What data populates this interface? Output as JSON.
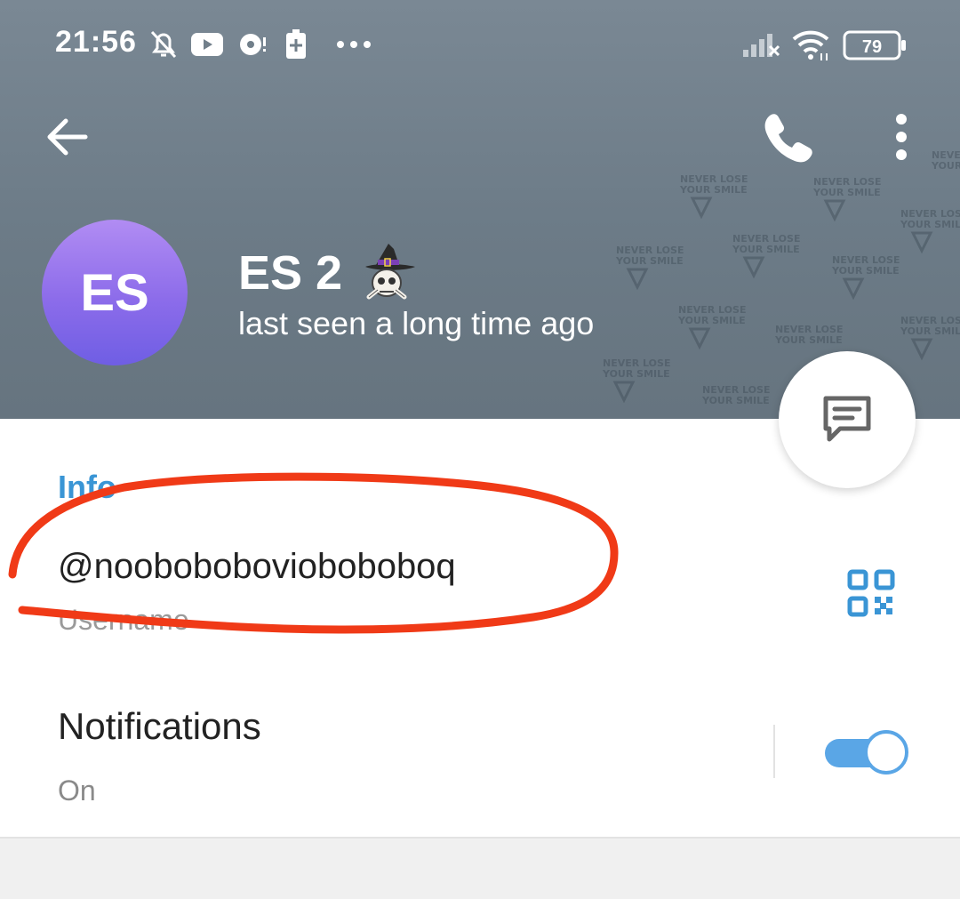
{
  "status_bar": {
    "time": "21:56",
    "battery_level": "79",
    "icons": [
      "bell-off-icon",
      "youtube-icon",
      "tape-recorder-icon",
      "battery-saver-icon",
      "more-dots-icon",
      "signal-icon",
      "wifi-icon",
      "battery-icon"
    ]
  },
  "toolbar": {
    "back_icon": "arrow-left-icon",
    "call_icon": "phone-icon",
    "more_icon": "more-vertical-icon"
  },
  "profile": {
    "avatar_initials": "ES",
    "name": "ES 2",
    "status": "last seen a long time ago",
    "avatar_color": "#8c6cea"
  },
  "background_pattern_text": [
    "NEVER LOSE",
    "YOUR SMILE"
  ],
  "info": {
    "section_title": "Info",
    "username": "@noobobobovioboboboq",
    "username_label": "Username",
    "qr_icon": "qr-code-icon"
  },
  "notifications": {
    "title": "Notifications",
    "status": "On",
    "enabled": true
  },
  "fab": {
    "icon": "message-icon"
  },
  "colors": {
    "accent": "#3a95d5",
    "header": "#6c7b87",
    "annotation": "#f03a17",
    "toggle": "#5aa6e6"
  }
}
